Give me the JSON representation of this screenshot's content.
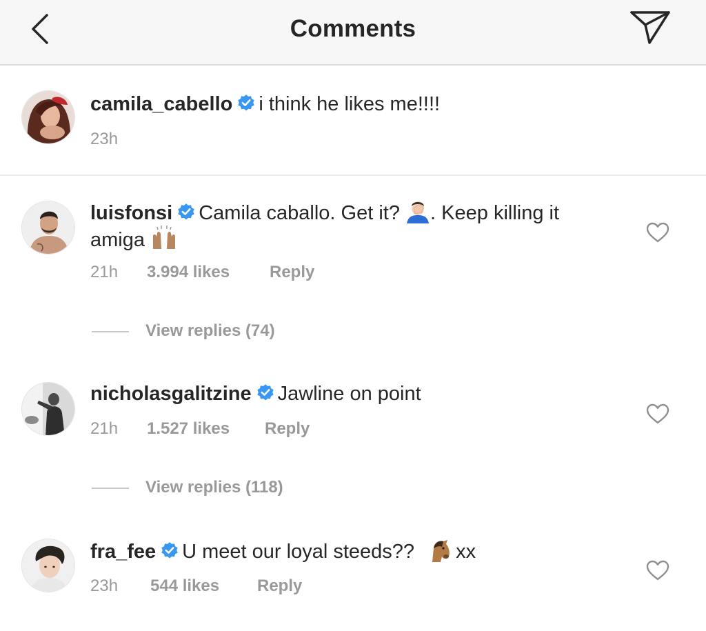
{
  "header": {
    "title": "Comments",
    "back_icon": "chevron-left-icon",
    "share_icon": "paper-plane-icon"
  },
  "colors": {
    "header_bg": "#f7f7f7",
    "text": "#262626",
    "meta": "#999999",
    "verified": "#3897f0",
    "divider": "#dbdbdb"
  },
  "caption": {
    "username": "camila_cabello",
    "verified": true,
    "text": "i think he likes me!!!!",
    "time": "23h"
  },
  "comments": [
    {
      "username": "luisfonsi",
      "verified": true,
      "text_part1": "Camila caballo. Get it?",
      "emoji1": "face-palm-emoji",
      "text_part2": ". Keep killing it",
      "text_line2": "amiga",
      "emoji2": "raising-hands-emoji",
      "time": "21h",
      "likes": "3.994 likes",
      "reply_label": "Reply",
      "view_replies": "View replies (74)"
    },
    {
      "username": "nicholasgalitzine",
      "verified": true,
      "text": "Jawline on point",
      "time": "21h",
      "likes": "1.527 likes",
      "reply_label": "Reply",
      "view_replies": "View replies (118)"
    },
    {
      "username": "fra_fee",
      "verified": true,
      "text": "U meet our loyal steeds??",
      "emoji": "horse-face-emoji",
      "text_after": "xx",
      "time": "23h",
      "likes": "544 likes",
      "reply_label": "Reply"
    }
  ]
}
